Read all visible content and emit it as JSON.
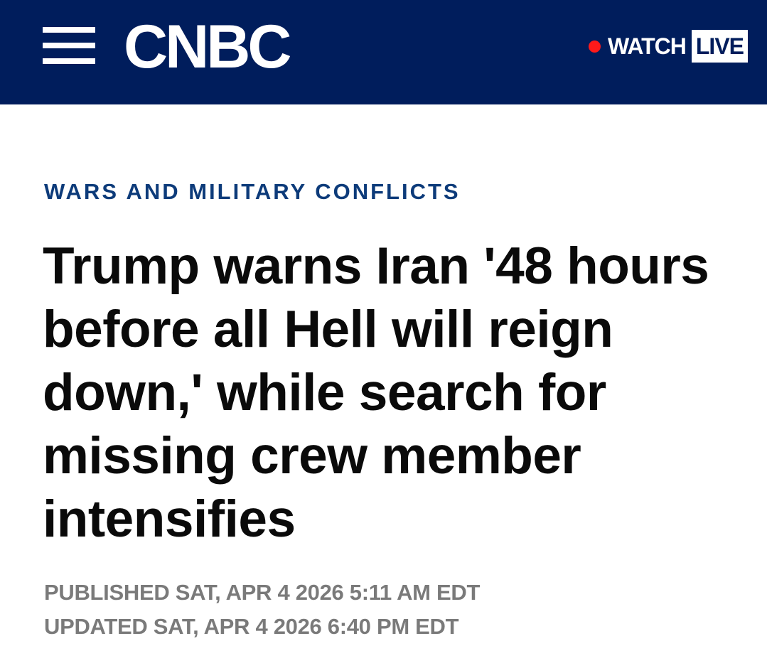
{
  "header": {
    "brand": "CNBC",
    "watch_label": "WATCH",
    "live_label": "LIVE",
    "colors": {
      "background": "#001d5c",
      "live_dot": "#ff1a1a",
      "text": "#ffffff"
    }
  },
  "article": {
    "section": "WARS AND MILITARY CONFLICTS",
    "headline": "Trump warns Iran '48 hours before all Hell will reign down,' while search for missing crew member intensifies",
    "published": "PUBLISHED SAT, APR 4 2026 5:11 AM EDT",
    "updated": "UPDATED SAT, APR 4 2026 6:40 PM EDT",
    "colors": {
      "section": "#0d3b7a",
      "headline": "#0a0a0a",
      "meta": "#7a7a7a"
    }
  },
  "icons": {
    "menu": "hamburger-menu-icon",
    "live": "live-dot-icon"
  }
}
